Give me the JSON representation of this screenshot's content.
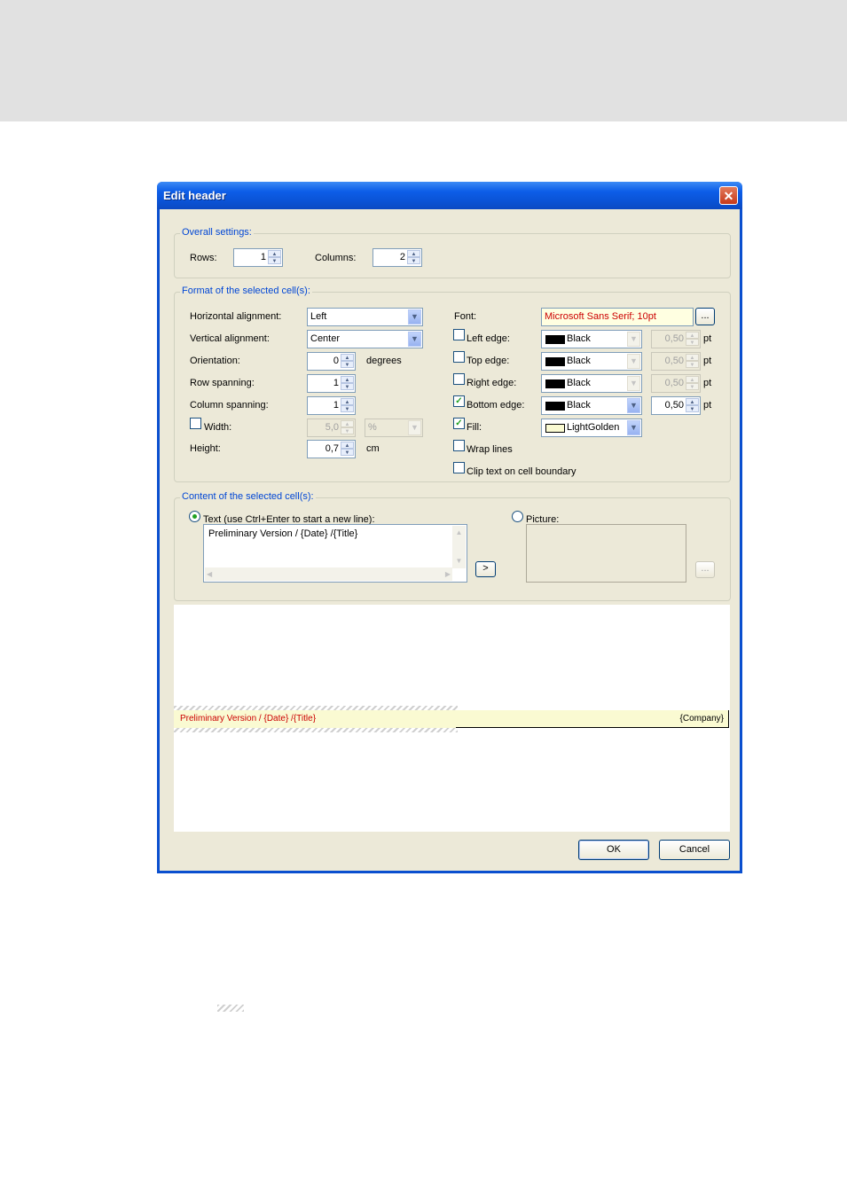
{
  "window": {
    "title": "Edit header",
    "close_glyph": "✕"
  },
  "overall": {
    "group_label": "Overall settings:",
    "rows_label": "Rows:",
    "rows_value": "1",
    "columns_label": "Columns:",
    "columns_value": "2"
  },
  "format": {
    "group_label": "Format of the selected cell(s):",
    "halign_label": "Horizontal alignment:",
    "halign_value": "Left",
    "valign_label": "Vertical alignment:",
    "valign_value": "Center",
    "orientation_label": "Orientation:",
    "orientation_value": "0",
    "orientation_unit": "degrees",
    "rowspan_label": "Row spanning:",
    "rowspan_value": "1",
    "colspan_label": "Column spanning:",
    "colspan_value": "1",
    "width_label": "Width:",
    "width_value": "5,0",
    "width_unit": "%",
    "width_checked": false,
    "height_label": "Height:",
    "height_value": "0,7",
    "height_unit": "cm",
    "font_label": "Font:",
    "font_value": "Microsoft Sans Serif; 10pt",
    "font_button": "...",
    "font_color": "#cc0000",
    "font_bg": "#ffffe1",
    "edges": [
      {
        "label": "Left edge:",
        "checked": false,
        "color": "Black",
        "width": "0,50",
        "unit": "pt"
      },
      {
        "label": "Top edge:",
        "checked": false,
        "color": "Black",
        "width": "0,50",
        "unit": "pt"
      },
      {
        "label": "Right edge:",
        "checked": false,
        "color": "Black",
        "width": "0,50",
        "unit": "pt"
      },
      {
        "label": "Bottom edge:",
        "checked": true,
        "color": "Black",
        "width": "0,50",
        "unit": "pt"
      }
    ],
    "fill_label": "Fill:",
    "fill_checked": true,
    "fill_value": "LightGolden",
    "fill_color": "#fafad2",
    "wrap_label": "Wrap lines",
    "wrap_checked": false,
    "clip_label": "Clip text on cell boundary",
    "clip_checked": false
  },
  "content": {
    "group_label": "Content of the selected cell(s):",
    "text_radio_label": "Text (use Ctrl+Enter to start a new line):",
    "text_value": "Preliminary Version / {Date} /{Title}",
    "insert_button": ">",
    "picture_radio_label": "Picture:",
    "picture_button": "..."
  },
  "preview": {
    "cell1_text": "Preliminary Version / {Date} /{Title}",
    "cell2_text": "{Company}"
  },
  "buttons": {
    "ok": "OK",
    "cancel": "Cancel"
  },
  "colors": {
    "accent": "#0046d5",
    "dialog_bg": "#ece9d8",
    "titlebar": "#0a53d6"
  }
}
